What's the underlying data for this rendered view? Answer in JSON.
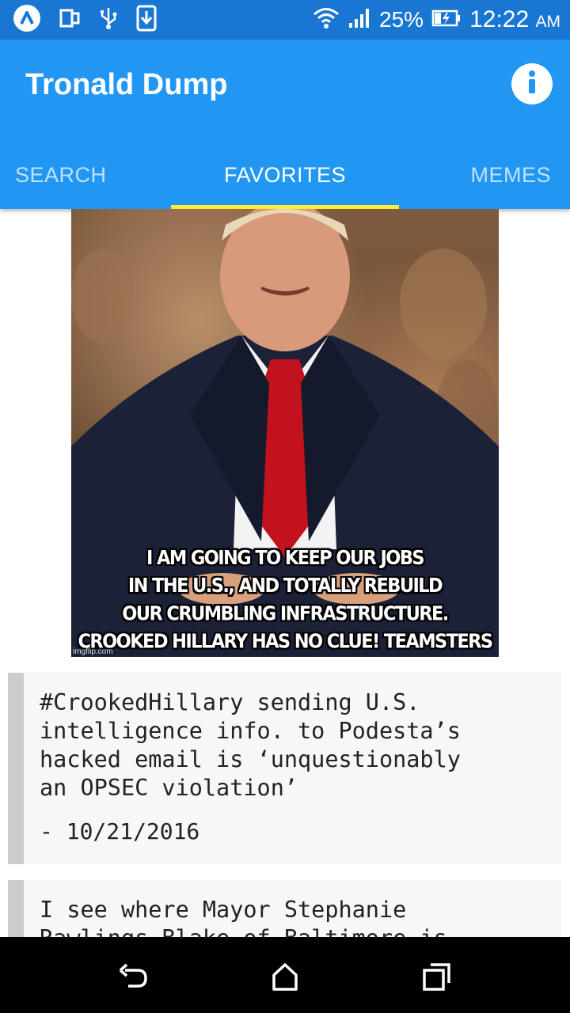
{
  "status_bar": {
    "battery": "25%",
    "time": "12:22",
    "ampm": "AM",
    "icons": [
      "app-logo-icon",
      "screen-mirror-icon",
      "usb-icon",
      "download-icon",
      "wifi-icon",
      "signal-icon",
      "battery-charging-icon"
    ]
  },
  "app_bar": {
    "title": "Tronald Dump",
    "info_icon": "info-icon",
    "tabs": [
      {
        "label": "SEARCH",
        "active": false
      },
      {
        "label": "FAVORITES",
        "active": true
      },
      {
        "label": "MEMES",
        "active": false
      }
    ],
    "indicator_color": "#ffeb3b"
  },
  "meme": {
    "caption_lines": [
      "I AM GOING TO KEEP OUR JOBS",
      "IN THE U.S., AND TOTALLY REBUILD",
      "OUR CRUMBLING INFRASTRUCTURE.",
      "CROOKED HILLARY HAS NO CLUE! TEAMSTERS"
    ],
    "watermark": "imgflip.com"
  },
  "quotes": [
    {
      "lines": [
        "#CrookedHillary sending U.S.",
        "intelligence info. to Podesta’s",
        "hacked email is ‘unquestionably",
        "an OPSEC violation’"
      ],
      "date": "- 10/21/2016"
    },
    {
      "lines": [
        "I see where Mayor Stephanie",
        "Rawlings-Blake of Baltimore is"
      ],
      "date": ""
    }
  ],
  "nav_bar": {
    "icons": [
      "back-icon",
      "home-icon",
      "recents-icon"
    ]
  },
  "colors": {
    "status_bar": "#1976d2",
    "app_bar": "#2196f3",
    "quote_bg": "#f7f7f7",
    "quote_border": "#cccccc"
  }
}
